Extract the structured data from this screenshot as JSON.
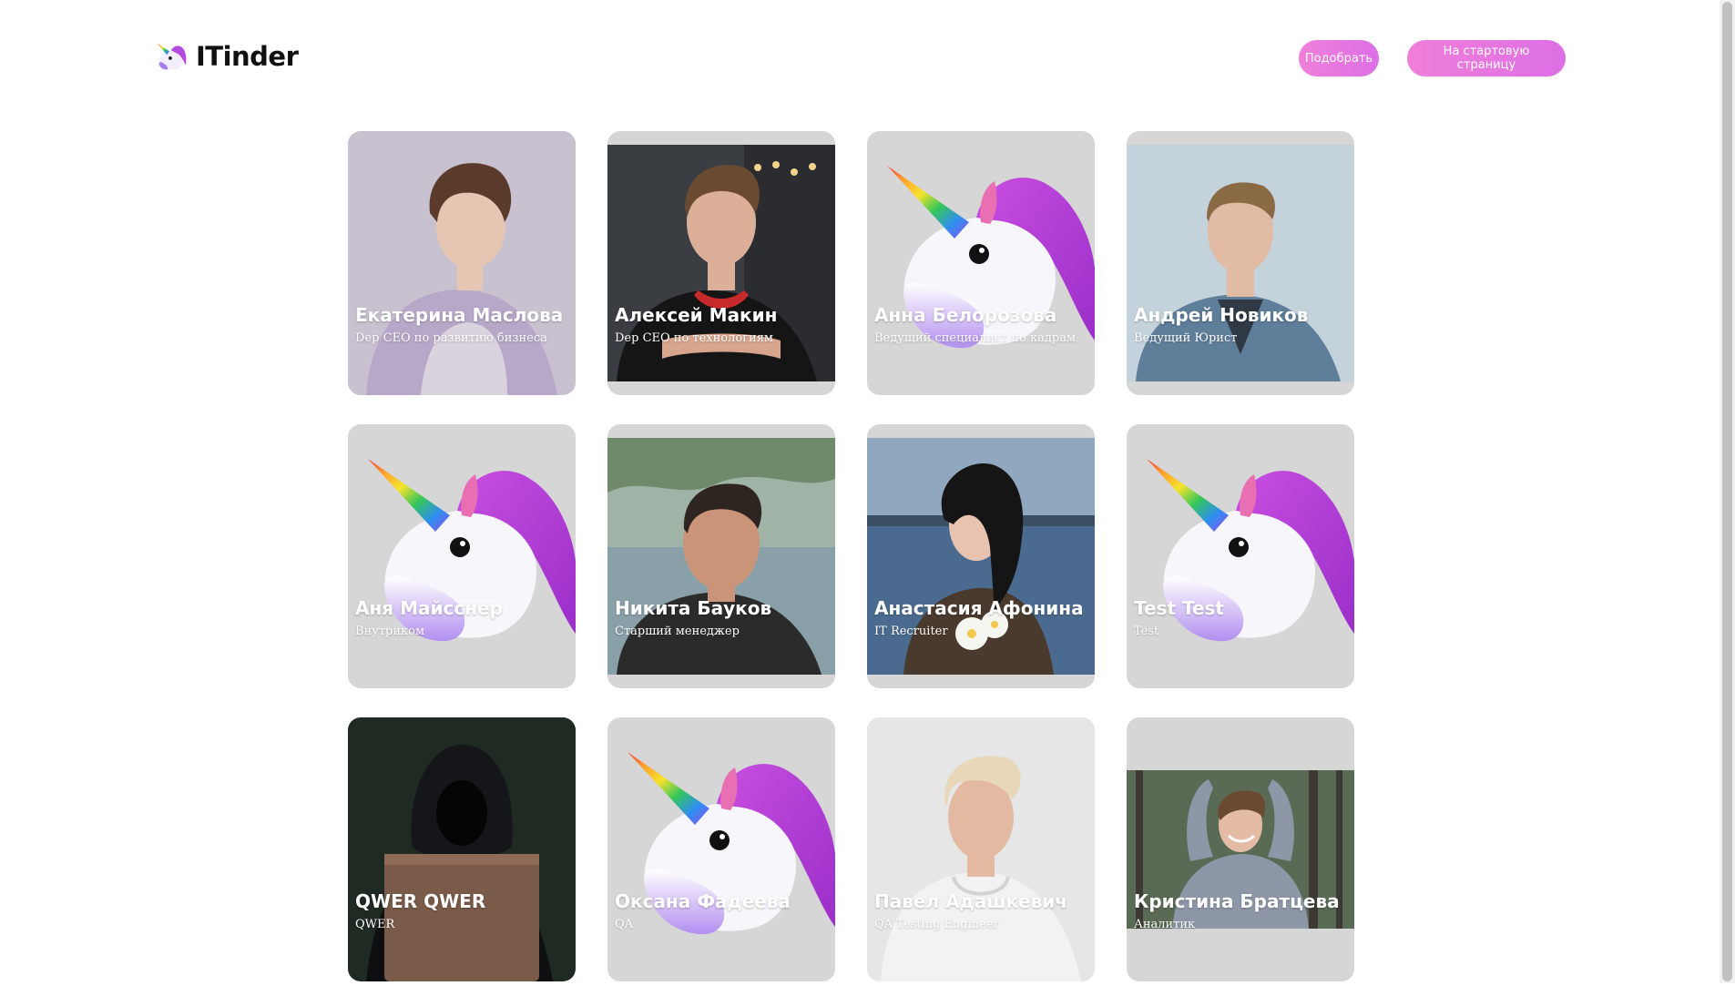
{
  "header": {
    "logo_text": "ITinder",
    "match_button": "Подобрать",
    "start_button": "На стартовую страницу"
  },
  "colors": {
    "accent": "#e56fd9",
    "card_bg": "#d6d6d6"
  },
  "cards": [
    {
      "name": "Екатерина Маслова",
      "role": "Dep CEO по развитию бизнеса",
      "avatar": "woman-photo"
    },
    {
      "name": "Алексей Макин",
      "role": "Dep CEO по технологиям",
      "avatar": "man-photo"
    },
    {
      "name": "Анна Белорозова",
      "role": "Ведущий специалист по кадрам",
      "avatar": "unicorn-placeholder"
    },
    {
      "name": "Андрей Новиков",
      "role": "Ведущий Юрист",
      "avatar": "man-photo"
    },
    {
      "name": "Аня Майсснер",
      "role": "Внутриком",
      "avatar": "unicorn-placeholder"
    },
    {
      "name": "Никита Бауков",
      "role": "Старший менеджер",
      "avatar": "man-photo"
    },
    {
      "name": "Анастасия Афонина",
      "role": "IT Recruiter",
      "avatar": "woman-photo"
    },
    {
      "name": "Test Test",
      "role": "Test",
      "avatar": "unicorn-placeholder"
    },
    {
      "name": "QWER QWER",
      "role": "QWER",
      "avatar": "hooded-hacker-photo"
    },
    {
      "name": "Оксана Фадеева",
      "role": "QA",
      "avatar": "unicorn-placeholder"
    },
    {
      "name": "Павел Адашкевич",
      "role": "QA Testing Engineer",
      "avatar": "man-photo"
    },
    {
      "name": "Кристина Братцева",
      "role": "Аналитик",
      "avatar": "woman-photo"
    }
  ]
}
